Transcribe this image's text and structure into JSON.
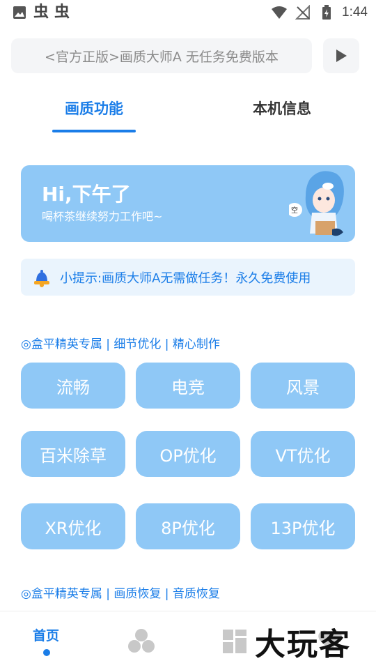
{
  "status_bar": {
    "app_glyphs": [
      "虫",
      "虫"
    ],
    "time": "1:44"
  },
  "header": {
    "search_text": "<官方正版>画质大师A 无任务免费版本"
  },
  "tabs": [
    {
      "label": "画质功能",
      "active": true
    },
    {
      "label": "本机信息",
      "active": false
    }
  ],
  "greeting": {
    "title": "Hi,下午了",
    "subtitle": "喝杯茶继续努力工作吧~"
  },
  "tip": {
    "text": "小提示:画质大师A无需做任务！永久免费使用"
  },
  "section1": {
    "label": "◎盒平精英专属 | 细节优化 | 精心制作",
    "options": [
      "流畅",
      "电竞",
      "风景",
      "百米除草",
      "OP优化",
      "VT优化",
      "XR优化",
      "8P优化",
      "13P优化"
    ]
  },
  "section2": {
    "label": "◎盒平精英专属 | 画质恢复 | 音质恢复"
  },
  "bottom_nav": {
    "home_label": "首页"
  },
  "watermark": "大玩客",
  "colors": {
    "accent": "#1a7de8",
    "button_bg": "#8fc8f6",
    "tip_bg": "#eaf4fd"
  }
}
